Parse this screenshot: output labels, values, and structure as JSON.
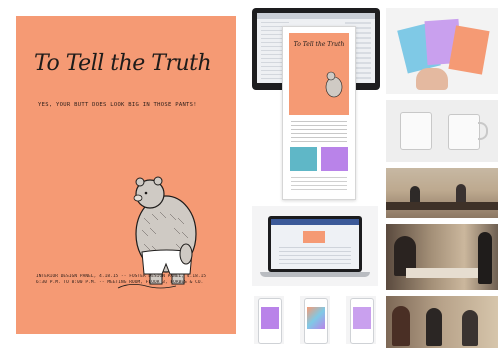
{
  "poster": {
    "title": "To Tell the Truth",
    "tagline": "YES, YOUR BUTT DOES LOOK BIG IN THOSE PANTS!",
    "footer_lines": [
      "INTERIOR DESIGN PANEL, 4.18.15 -- FOSTER DESIGN PANEL, 4.18.15",
      "6:30 P.M. TO 8:00 P.M. -- MEETING ROOM, FLOOR 3, FORBES & CO."
    ],
    "background_color": "#f59a74"
  },
  "gallery": {
    "center": [
      "email-on-monitor",
      "email-mockup",
      "laptop",
      "phone-1",
      "phone-2",
      "phone-3"
    ],
    "right": [
      "postcards-in-hand",
      "coffee-mugs",
      "panel-meeting-1",
      "panel-meeting-2",
      "panel-meeting-3"
    ]
  },
  "colors": {
    "accent_purple": "#b983e9",
    "accent_teal": "#5fb7c7",
    "accent_blue": "#7fc9e6"
  }
}
